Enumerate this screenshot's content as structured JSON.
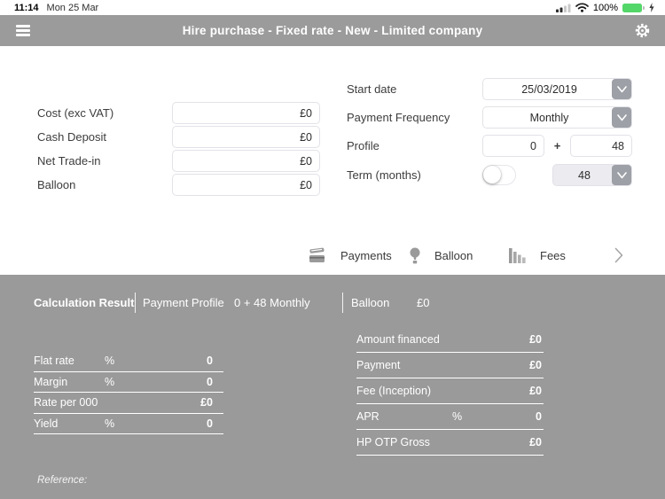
{
  "status_bar": {
    "time": "11:14",
    "date": "Mon 25 Mar",
    "battery_percent": "100%"
  },
  "header": {
    "title": "Hire purchase - Fixed rate - New - Limited company"
  },
  "form_left": {
    "rows": [
      {
        "label": "Cost (exc VAT)",
        "value": "£0"
      },
      {
        "label": "Cash Deposit",
        "value": "£0"
      },
      {
        "label": "Net Trade-in",
        "value": "£0"
      },
      {
        "label": "Balloon",
        "value": "£0"
      }
    ]
  },
  "form_right": {
    "start_date": {
      "label": "Start date",
      "value": "25/03/2019"
    },
    "payment_frequency": {
      "label": "Payment Frequency",
      "value": "Monthly"
    },
    "profile": {
      "label": "Profile",
      "first": "0",
      "plus": "+",
      "second": "48"
    },
    "term": {
      "label": "Term (months)",
      "value": "48",
      "toggle_on": false
    }
  },
  "tabs": {
    "items": [
      {
        "label": "Payments",
        "icon": "credit-cards-icon"
      },
      {
        "label": "Balloon",
        "icon": "hot-air-balloon-icon"
      },
      {
        "label": "Fees",
        "icon": "descending-bars-icon"
      }
    ],
    "more_icon": "chevron-right-icon"
  },
  "calculation": {
    "title": "Calculation Result",
    "payment_profile_label": "Payment Profile",
    "payment_profile_value": "0 + 48 Monthly",
    "balloon_label": "Balloon",
    "balloon_value": "£0",
    "left_rows": [
      {
        "label": "Flat rate",
        "unit": "%",
        "value": "0"
      },
      {
        "label": "Margin",
        "unit": "%",
        "value": "0"
      },
      {
        "label": "Rate per 000",
        "unit": "",
        "value": "£0"
      },
      {
        "label": "Yield",
        "unit": "%",
        "value": "0"
      }
    ],
    "right_rows": [
      {
        "label": "Amount financed",
        "unit": "",
        "value": "£0"
      },
      {
        "label": "Payment",
        "unit": "",
        "value": "£0"
      },
      {
        "label": "Fee (Inception)",
        "unit": "",
        "value": "£0"
      },
      {
        "label": "APR",
        "unit": "%",
        "value": "0"
      },
      {
        "label": "HP OTP Gross",
        "unit": "",
        "value": "£0"
      }
    ],
    "reference_label": "Reference:"
  },
  "icons": {
    "menu": "hamburger-bars",
    "settings": "gear",
    "payments": "credit-cards",
    "balloon": "hot-air-balloon",
    "fees": "descending-bars",
    "more": "chevron-right",
    "dropdown": "chevron-down",
    "wifi": "wifi-arcs",
    "cellular": "signal-bars",
    "battery": "battery-full-charging"
  },
  "colors": {
    "header_gray": "#9b9b9b",
    "results_gray": "#9a9a9a",
    "battery_green": "#53d769",
    "icon_gray": "#9a9a9a",
    "control_gray": "#9da0a6",
    "field_border": "#e2e2e8",
    "term_field_bg": "#ebebf0"
  }
}
